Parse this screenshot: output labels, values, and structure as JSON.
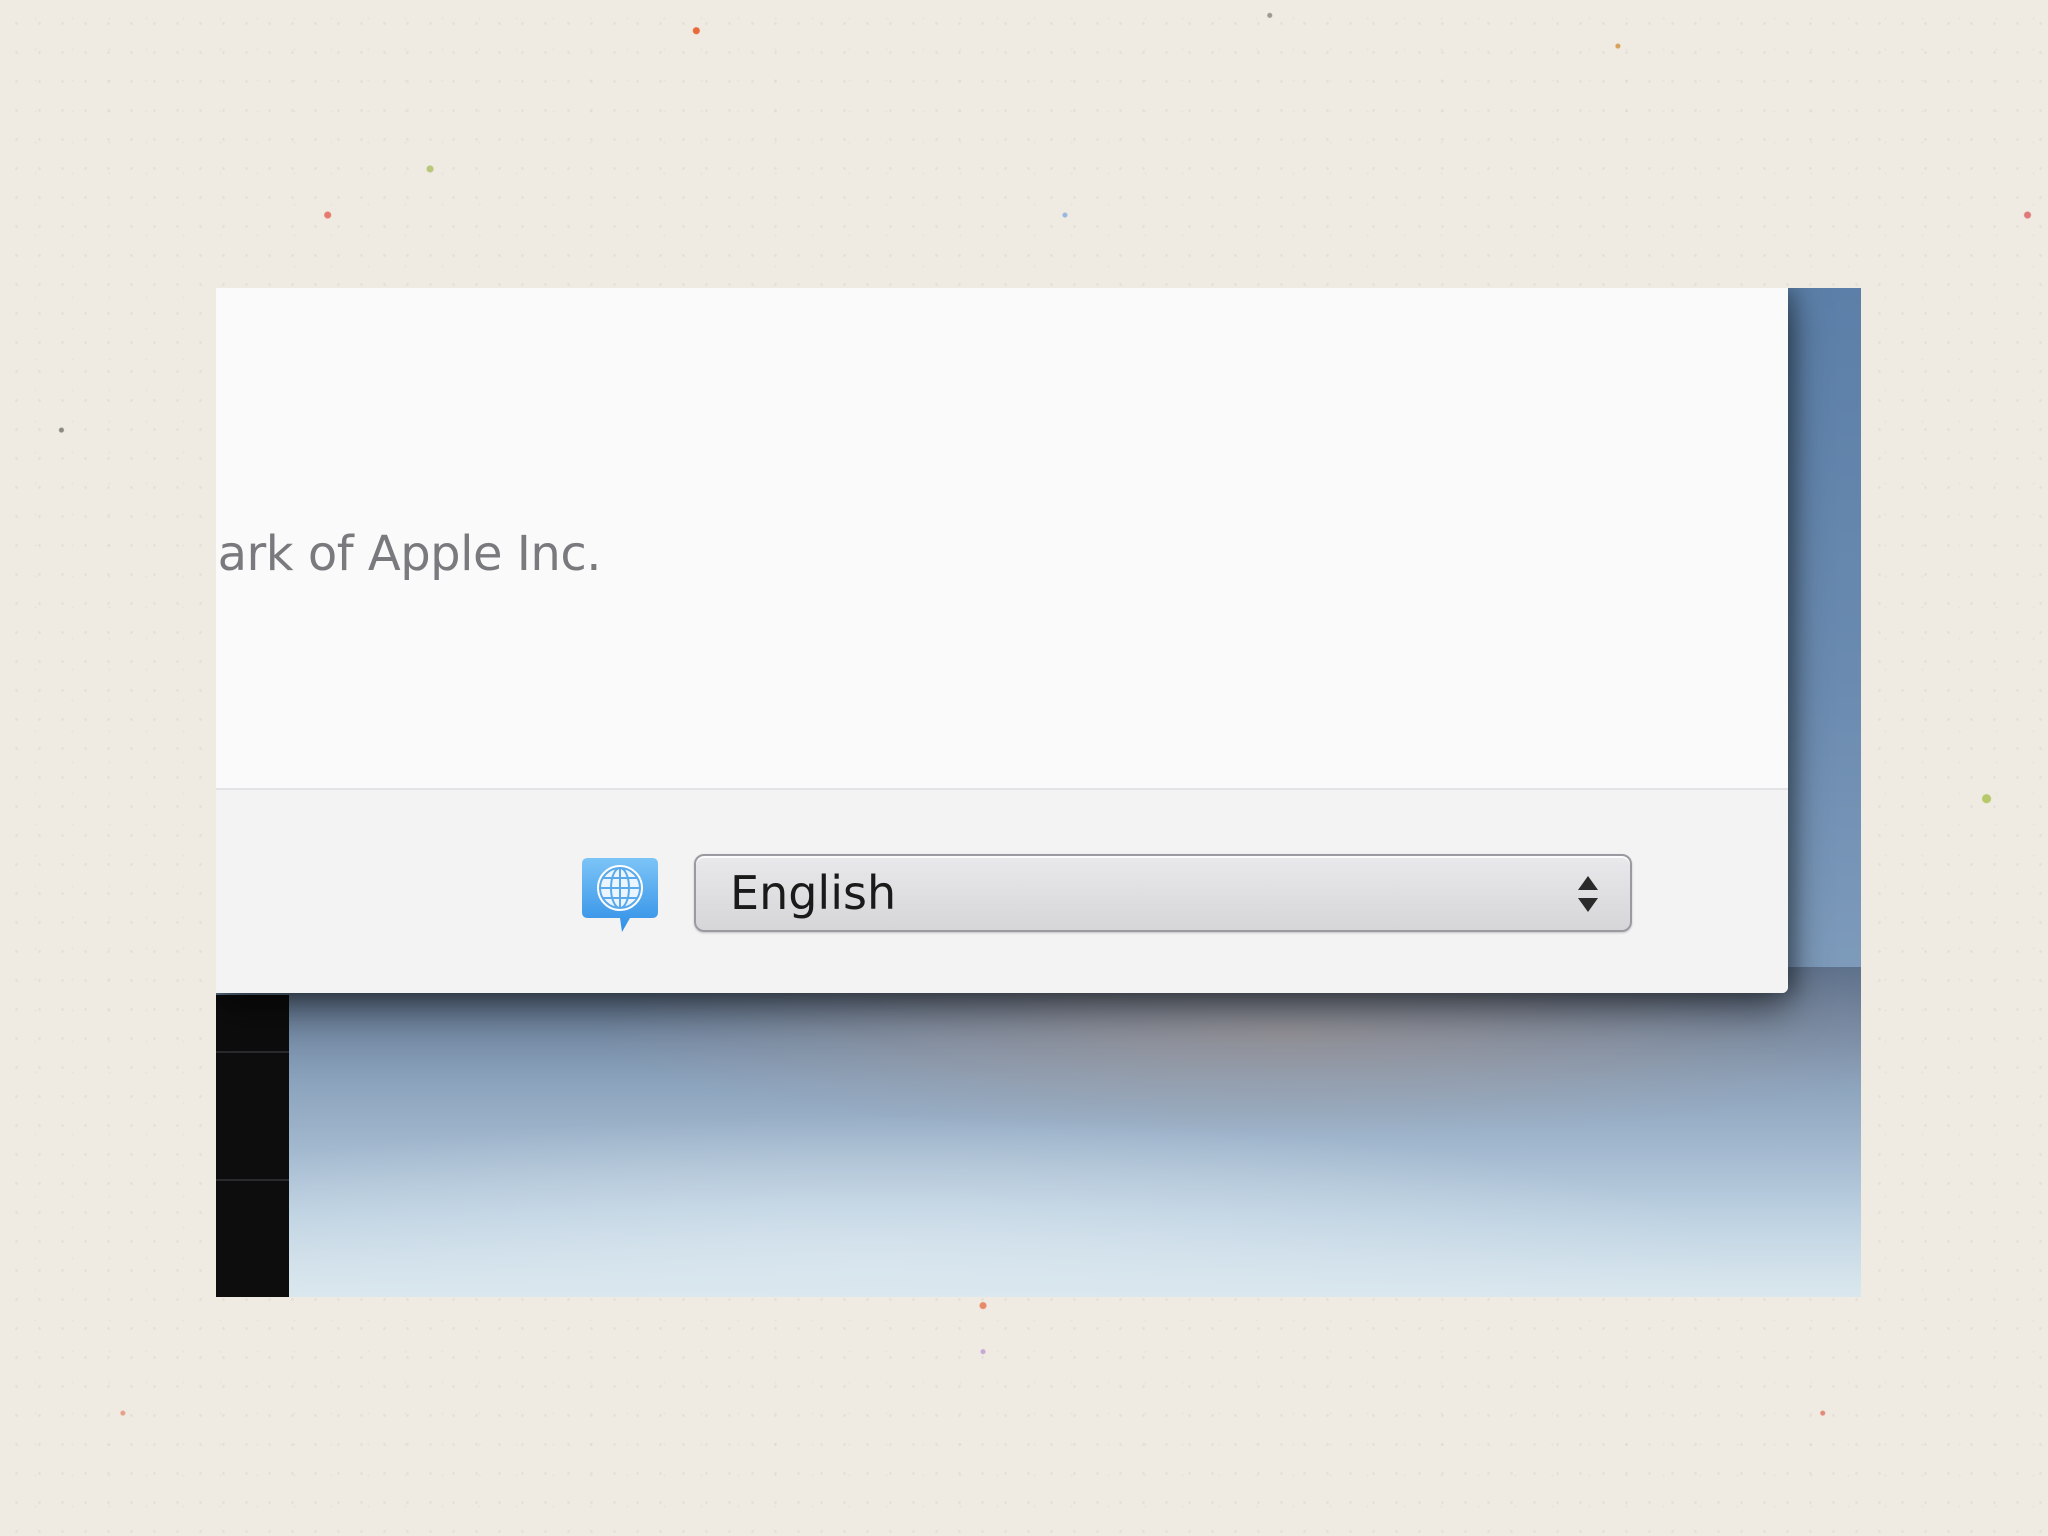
{
  "window": {
    "legal_text": "ark of Apple Inc."
  },
  "language": {
    "icon": "globe-speech-bubble-icon",
    "selected": "English"
  },
  "colors": {
    "icon_blue": "#4aa4ee",
    "select_border": "#9a9aa0",
    "window_bg": "#fafafb"
  }
}
